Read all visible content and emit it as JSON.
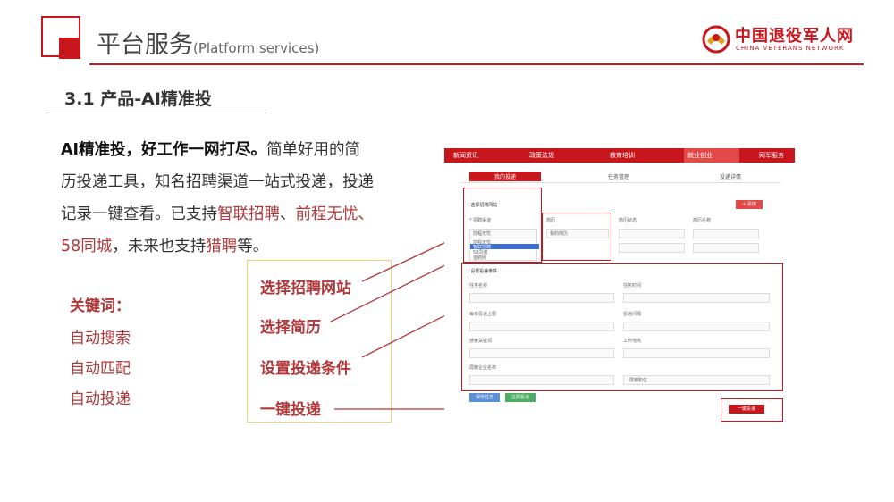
{
  "header": {
    "title": "平台服务",
    "subtitle": "(Platform services)",
    "brand_cn": "中国退役军人网",
    "brand_en": "CHINA VETERANS NETWORK"
  },
  "section": {
    "title": "3.1 产品-AI精准投"
  },
  "paragraph": {
    "bold": "AI精准投，好工作一网打尽。",
    "p1": "简单好用的简历投递工具，知名招聘渠道一站式投递，投递记录一键查看。已支持",
    "link1": "智联招聘",
    "sep1": "、",
    "link2": "前程无忧",
    "sep2": "、",
    "link3": "58同城",
    "p2": "，未来也支持",
    "link4": "猎聘",
    "p3": "等。"
  },
  "keywords": {
    "title": "关键词：",
    "items": [
      "自动搜索",
      "自动匹配",
      "自动投递"
    ]
  },
  "steps": [
    "选择招聘网站",
    "选择简历",
    "设置投递条件",
    "一键投递"
  ],
  "mock": {
    "nav": [
      "新闻资讯",
      "政策法规",
      "教育培训",
      "就业创业",
      "网军服务"
    ],
    "tabs": [
      "我的投递",
      "任务管理",
      "投递详情"
    ],
    "sec1": "| 选择招聘网站",
    "sec2": "| 设置投递条件",
    "site_label": "* 招聘渠道",
    "site_value": "前程无忧",
    "site_options": [
      "前程无忧",
      "智联招聘",
      "58同城",
      "猎聘网"
    ],
    "resume_label": "简历",
    "resume_value": "我的简历",
    "col3": "简历状态",
    "col4": "简历名称",
    "add_btn": "+ 添加",
    "cond_labels": [
      "任务名称",
      "任务时间",
      "每日投递上限",
      "投递间隔",
      "搜索关键词",
      "工作地点",
      "屏蔽企业名称",
      "屏蔽职位"
    ],
    "btn1": "保存任务",
    "btn2": "立即投递",
    "btn3": "一键投递"
  },
  "colors": {
    "accent": "#c8161d",
    "text_red": "#b0383a",
    "box_yellow": "#e8d37a"
  }
}
